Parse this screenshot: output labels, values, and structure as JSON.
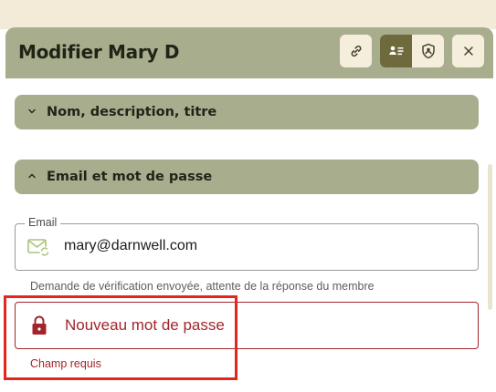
{
  "dialog": {
    "title": "Modifier Mary D",
    "buttons": {
      "link": "link-icon",
      "profile": "profile-list-icon",
      "security": "shield-icon",
      "close": "close-icon"
    }
  },
  "sections": [
    {
      "label": "Nom, description, titre",
      "expanded": false
    },
    {
      "label": "Email et mot de passe",
      "expanded": true
    }
  ],
  "email": {
    "legend": "Email",
    "value": "mary@darnwell.com",
    "helper": "Demande de vérification envoyée, attente de la réponse du membre",
    "icon": "mail-sync-icon"
  },
  "password": {
    "placeholder": "Nouveau mot de passe",
    "error": "Champ requis",
    "icon": "lock-icon"
  },
  "colors": {
    "header": "#a7ad8d",
    "accent": "#6f6a3e",
    "error": "#a3252c",
    "highlight": "#e3271d"
  }
}
